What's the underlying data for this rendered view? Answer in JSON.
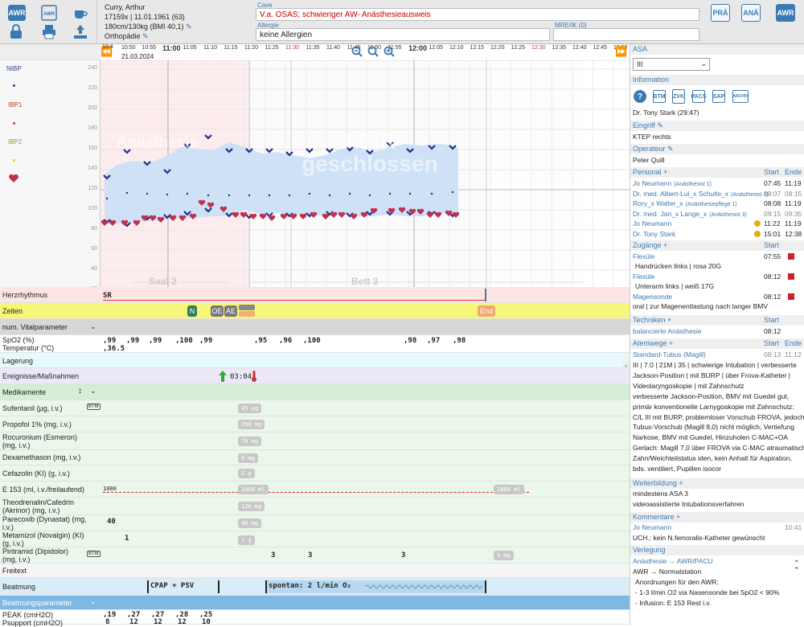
{
  "toolbar": {
    "awr_label": "AWR",
    "pra_label": "PRÄ",
    "ana_label": "ANÄ",
    "awr2_label": "AWR"
  },
  "patient": {
    "name": "Curry, Arthur",
    "id_line": "17159x | 11.01.1961 (63)",
    "body_line": "180cm/130kg (BMI 40,1)",
    "dept": "Orthopädie"
  },
  "cave": {
    "label": "Cave",
    "value": "V.a. OSAS; schwieriger AW- Anästhesieausweis"
  },
  "allergie": {
    "label": "Allergie",
    "value": "keine Allergien"
  },
  "mre": {
    "label": "MRE/IK (0)",
    "value": ""
  },
  "timeline": {
    "date": "21.03.2024",
    "ticks": [
      "10:50",
      "10:55",
      "11:00",
      "11:05",
      "11:10",
      "11:15",
      "11:20",
      "11:25",
      "11:30",
      "11:35",
      "11:40",
      "11:45",
      "11:50",
      "11:55",
      "12:00",
      "12:05",
      "12:10",
      "12:15",
      "12:20",
      "12:25",
      "12:30",
      "12:35",
      "12:40",
      "12:45",
      "12:50"
    ],
    "first_tick": "10:4"
  },
  "yaxis": [
    "240",
    "220",
    "200",
    "180",
    "160",
    "140",
    "120",
    "100",
    "80",
    "60",
    "40",
    "20"
  ],
  "legend": {
    "nibp": "NIBP",
    "ibp1": "IBP1",
    "ibp2": "IBP2"
  },
  "watermarks": {
    "anaesthesie": "Anästhesie",
    "awr": "AWR geschlossen",
    "saal": "Saal 2",
    "bett": "Bett 3"
  },
  "rows": {
    "herzrhythmus": "Herzrhythmus",
    "zeiten": "Zeiten",
    "num_vital": "num. Vitalparameter",
    "spo2": "SpO2 (%)",
    "temp": "Temperatur (°C)",
    "lagerung": "Lagerung",
    "ereignisse": "Ereignisse/Maßnahmen",
    "medikamente": "Medikamente",
    "sufentanil": "Sufentanil (µg, i.v.)",
    "propofol": "Propofol 1% (mg, i.v.)",
    "rocuronium": "Rocuronium (Esmeron) (mg, i.v.)",
    "dexa": "Dexamethason (mg, i.v.)",
    "cefazolin": "Cefazolin (KI) (g, i.v.)",
    "e153": "E 153 (ml, i.v./freilaufend)",
    "theo": "Theodrenalin/Cafedrin (Akrinor) (mg, i.v.)",
    "parecoxib": "Parecoxib (Dynastat) (mg, i.v.)",
    "metamizol": "Metamizol (Novalgin) (KI) (g, i.v.)",
    "piritramid": "Piritramid (Dipidolor) (mg, i.v.)",
    "freitext": "Freitext",
    "beatmung": "Beatmung",
    "beatmungsparameter": "Beatmungsparameter",
    "peak": "PEAK (cmH2O)",
    "psupport": "Psupport (cmH2O)"
  },
  "chartvals": {
    "sr": "SR",
    "n": "N",
    "oe": "OE",
    "ae": "AE",
    "end": "End",
    "ereignis_time": "03:04",
    "spo2": [
      ",99",
      ",99",
      ",99",
      ",100",
      ",99",
      ",95",
      ",96",
      ",100",
      ",98",
      ",97",
      ",98"
    ],
    "temp": ",36.5",
    "sufentanil": "45 µg",
    "propofol": "280 mg",
    "rocuronium": "70 mg",
    "dexa": "8 mg",
    "cefazolin": "2 g",
    "e153_left": "1000",
    "e153_pill": "1000 ml",
    "e153_right": "1000 ml",
    "theo": "120 mg",
    "parecoxib": "40 mg",
    "parecoxib_val": "40",
    "metamizol": "1 g",
    "metamizol_val": "1",
    "piritramid_vals": [
      "3",
      "3",
      "3"
    ],
    "piritramid_pill": "9 mg",
    "cpap": "CPAP + PSV",
    "spontan": "spontan: 2 l/min O₂",
    "peak": [
      ",19",
      ",27",
      ",27",
      ",28",
      ",25"
    ],
    "psupport": [
      "8",
      "12",
      "12",
      "12",
      "10"
    ]
  },
  "asa": {
    "title": "ASA",
    "value": "III"
  },
  "information": {
    "title": "Information",
    "icons": [
      "BTM",
      "ZVK",
      "PACS",
      "SAP",
      "ARCHIV"
    ],
    "doctor": "Dr. Tony Stark (29:47)"
  },
  "eingriff": {
    "title": "Eingriff",
    "value": "KTEP rechts"
  },
  "operateur": {
    "title": "Operateur",
    "value": "Peter Quill"
  },
  "personal": {
    "title": "Personal",
    "start": "Start",
    "ende": "Ende",
    "items": [
      {
        "name": "Jo Neumann",
        "role": "(Anästhesist 1)",
        "start": "07:45",
        "end": "11:19"
      },
      {
        "name": "Dr. med. Albert-Lui_x Schulte_x",
        "role": "(Anästhesist 2)",
        "start": "08:07",
        "end": "08:15"
      },
      {
        "name": "Rory_x Walter_x",
        "role": "(Anästhesiepflege 1)",
        "start": "08:08",
        "end": "11:19"
      },
      {
        "name": "Dr. med. Jan_x Lange_x",
        "role": "(Anästhesist 3)",
        "start": "09:15",
        "end": "09:35"
      },
      {
        "name": "Jo Neumann",
        "role": "",
        "start": "11:22",
        "end": "11:19"
      },
      {
        "name": "Dr. Tony Stark",
        "role": "",
        "start": "15:01",
        "end": "12:38"
      }
    ]
  },
  "zugaenge": {
    "title": "Zugänge",
    "start": "Start",
    "items": [
      {
        "name": "Flexüle",
        "detail": "Handrücken links | rosa 20G",
        "start": "07:55"
      },
      {
        "name": "Flexüle",
        "detail": "Unterarm links | weiß 17G",
        "start": "08:12"
      },
      {
        "name": "Magensonde",
        "detail": "oral | zur Magenentlastung nach langer BMV",
        "start": "08:12"
      }
    ]
  },
  "techniken": {
    "title": "Techniken",
    "start": "Start",
    "name": "balancierte Anästhesie",
    "time": "08:12"
  },
  "atemwege": {
    "title": "Atemwege",
    "start": "Start",
    "ende": "Ende",
    "name": "Standard-Tubus (Magill)",
    "start_t": "08:13",
    "end_t": "11:12",
    "lines": [
      "III | 7.0 | 21M | 35 | schwierige Intubation | verbesserte",
      "Jackson-Position | mit BURP | über Frova-Katheter |",
      "Videolaryngoskopie | mit Zahnschutz",
      "verbesserte Jackson-Position, BMV mit Guedel gut,",
      "primär konventionelle Larnygoskopie mit Zahnschutz:",
      "C/L III mit BURP, problemloser Vorschub FROVA, jedoch",
      "Tubus-Vorschub (Magill 8,0) nicht möglich; Vertiefung",
      "Narkose, BMV mit Guedel, Hinzuholen C-MAC+OA",
      "Gerlach: Magill 7,0 über FROVA via C-MAC atraumatisch,",
      "Zahn/Weichteilstatus iden, kein Anhalt für Aspiration,",
      "bds. ventiliert, Pupillen isocor"
    ]
  },
  "weiterbildung": {
    "title": "Weiterbildung",
    "lines": [
      "mindestens ASA 3",
      "videoassistierte Intubationsverfahren"
    ]
  },
  "kommentare": {
    "title": "Kommentare",
    "author": "Jo Neumann",
    "time": "10:41",
    "text": "UCH.; kein N.femoralis-Katheter gewünscht"
  },
  "verlegung": {
    "title": "Verlegung",
    "row1": "Anästhesie → AWR/PACU",
    "row2": "AWR → Normalstation",
    "lines": [
      "Anordnungen für den AWR:",
      "- 1-3 l/min O2 via Nasensonde bei SpO2 < 90%",
      "- Infusion: E 153 Rest i.v."
    ]
  }
}
